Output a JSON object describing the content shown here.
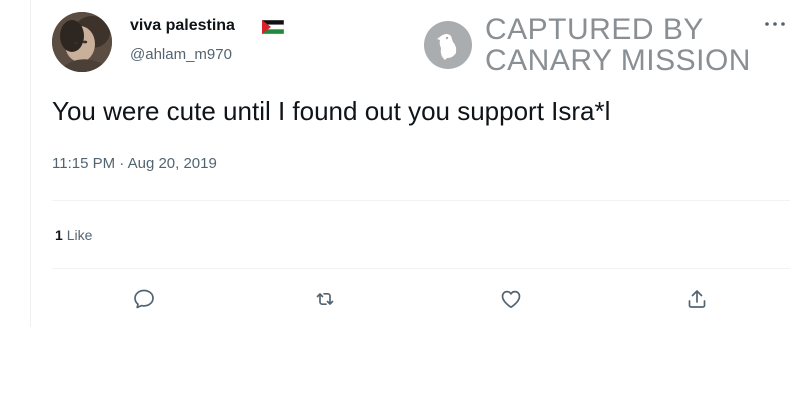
{
  "tweet": {
    "display_name": "viva palestina",
    "handle": "@ahlam_m970",
    "text": "You were cute until I found out you support Isra*l",
    "timestamp": "11:15 PM · Aug 20, 2019",
    "likes_count": "1",
    "likes_label": "Like"
  },
  "watermark": {
    "line1": "CAPTURED BY",
    "line2": "CANARY MISSION"
  },
  "icons": {
    "flag": "palestinian-flag-icon",
    "more": "more-icon",
    "reply": "reply-icon",
    "retweet": "retweet-icon",
    "like": "heart-icon",
    "share": "share-icon"
  },
  "colors": {
    "text_primary": "#0f1419",
    "text_secondary": "#536471",
    "watermark": "#8a8f93",
    "divider": "#eff3f4"
  }
}
